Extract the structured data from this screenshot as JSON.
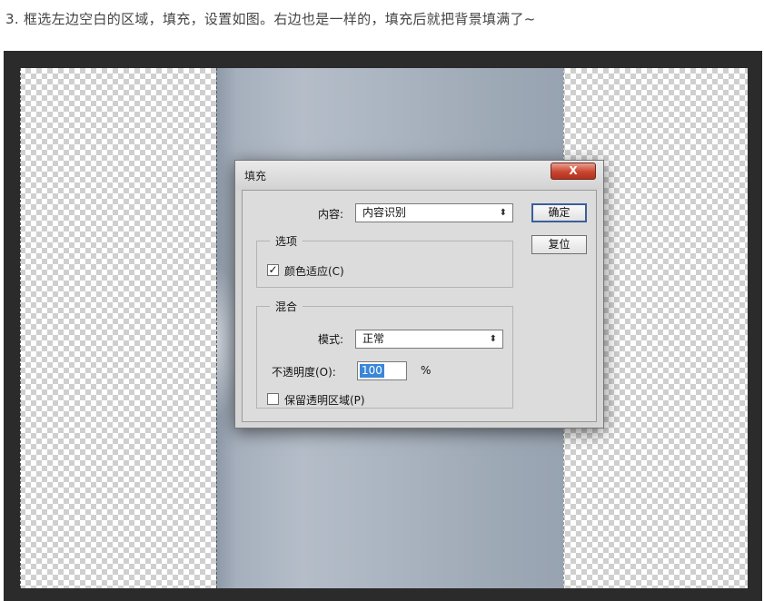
{
  "caption": "3. 框选左边空白的区域，填充，设置如图。右边也是一样的，填充后就把背景填满了~",
  "dialog": {
    "title": "填充",
    "close_label": "X",
    "content_label": "内容:",
    "content_value": "内容识别",
    "ok_label": "确定",
    "reset_label": "复位",
    "options_group": "选项",
    "color_adapt_label": "颜色适应(C)",
    "color_adapt_checked": true,
    "blend_group": "混合",
    "mode_label": "模式:",
    "mode_value": "正常",
    "opacity_label": "不透明度(O):",
    "opacity_value": "100",
    "opacity_unit": "%",
    "preserve_label": "保留透明区域(P)",
    "preserve_checked": false,
    "check_mark": "✓",
    "select_arrow": "⬍"
  }
}
